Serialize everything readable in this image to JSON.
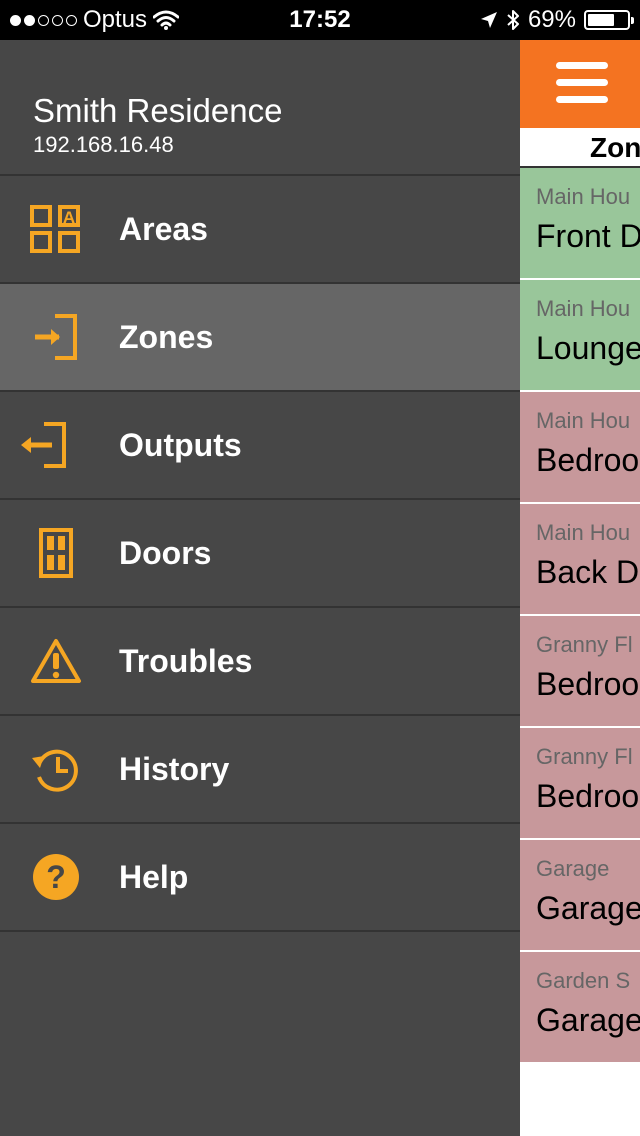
{
  "status_bar": {
    "signal_filled": 2,
    "signal_total": 5,
    "carrier": "Optus",
    "time": "17:52",
    "battery_percent": "69%",
    "battery_level": 0.69
  },
  "menu": {
    "site_name": "Smith Residence",
    "site_ip": "192.168.16.48",
    "accent_color": "#F5A623",
    "items": [
      {
        "label": "Areas",
        "icon": "areas-icon"
      },
      {
        "label": "Zones",
        "icon": "zone-enter-icon",
        "selected": true
      },
      {
        "label": "Outputs",
        "icon": "output-exit-icon"
      },
      {
        "label": "Doors",
        "icon": "door-icon"
      },
      {
        "label": "Troubles",
        "icon": "warning-icon"
      },
      {
        "label": "History",
        "icon": "history-icon"
      },
      {
        "label": "Help",
        "icon": "help-icon"
      }
    ]
  },
  "main": {
    "title": "Zon",
    "header_color": "#F47321",
    "zones": [
      {
        "area": "Main Hou",
        "name": "Front D",
        "state": "green"
      },
      {
        "area": "Main Hou",
        "name": "Lounge",
        "state": "green"
      },
      {
        "area": "Main Hou",
        "name": "Bedroo",
        "state": "red"
      },
      {
        "area": "Main Hou",
        "name": "Back D",
        "state": "red"
      },
      {
        "area": "Granny Fl",
        "name": "Bedroo",
        "state": "red"
      },
      {
        "area": "Granny Fl",
        "name": "Bedroo",
        "state": "red"
      },
      {
        "area": "Garage",
        "name": "Garage",
        "state": "red"
      },
      {
        "area": "Garden S",
        "name": "Garage",
        "state": "red"
      }
    ]
  }
}
